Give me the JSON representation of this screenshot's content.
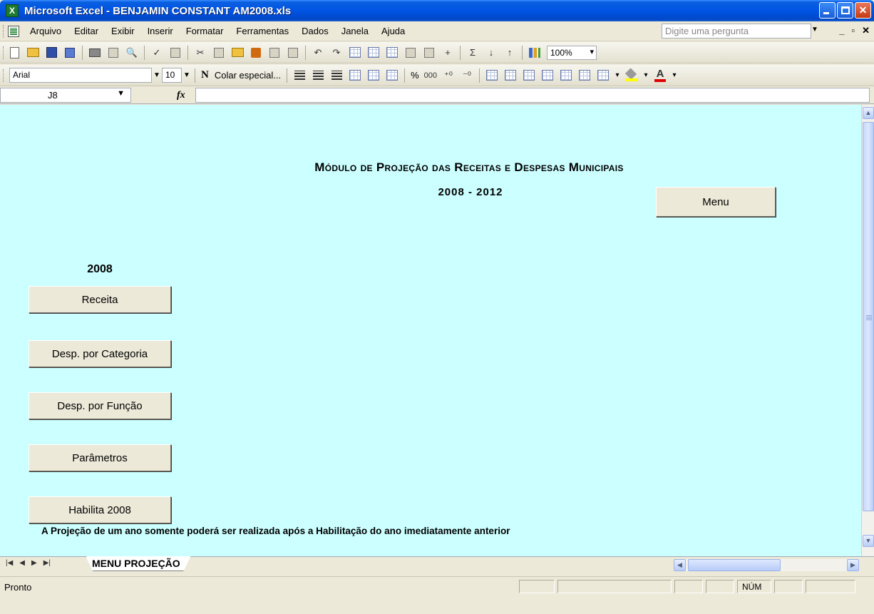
{
  "window": {
    "app_icon": "excel-icon",
    "title": "Microsoft Excel - BENJAMIN CONSTANT AM2008.xls"
  },
  "menubar": {
    "items": [
      "Arquivo",
      "Editar",
      "Exibir",
      "Inserir",
      "Formatar",
      "Ferramentas",
      "Dados",
      "Janela",
      "Ajuda"
    ],
    "question_placeholder": "Digite uma pergunta"
  },
  "toolbar_standard": {
    "zoom": "100%"
  },
  "toolbar_formatting": {
    "font": "Arial",
    "size": "10",
    "bold_label": "N",
    "paste_special": "Colar especial...",
    "percent": "%",
    "thousands": "000"
  },
  "formula_bar": {
    "cell_ref": "J8",
    "fx_label": "fx",
    "formula": ""
  },
  "sheet": {
    "title": "Módulo de Projeção das Receitas e Despesas Municipais",
    "years": "2008 - 2012",
    "menu_button": "Menu",
    "year_label": "2008",
    "buttons": [
      "Receita",
      "Desp. por Categoria",
      "Desp. por Função",
      "Parâmetros",
      "Habilita 2008"
    ],
    "note": "A Projeção de um ano somente poderá ser realizada após a Habilitação do ano imediatamente anterior"
  },
  "tabs": {
    "active": "MENU PROJEÇÃO"
  },
  "status": {
    "text": "Pronto",
    "num": "NÚM"
  },
  "colors": {
    "titlebar": "#0054e3",
    "sheet_background": "#ccffff",
    "button_face": "#ece9d8"
  }
}
